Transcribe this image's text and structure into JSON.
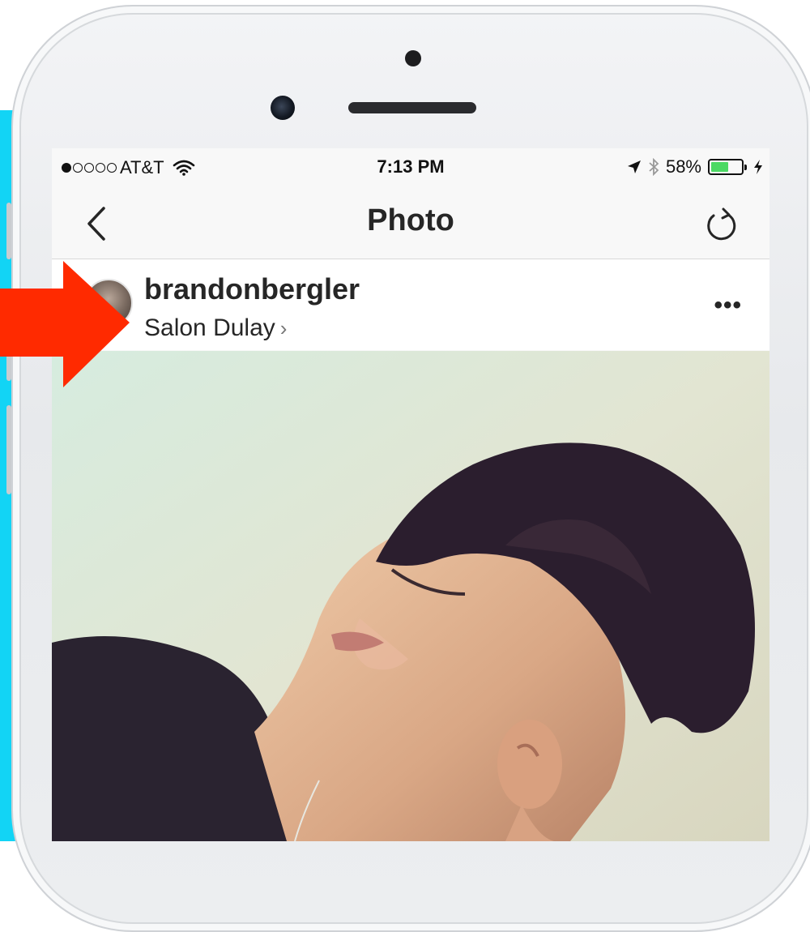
{
  "status_bar": {
    "carrier": "AT&T",
    "time": "7:13 PM",
    "battery_percent": "58%",
    "battery_level": 0.58,
    "signal_bars": 1,
    "signal_total": 5
  },
  "nav": {
    "title": "Photo",
    "back_icon": "chevron-left-icon",
    "refresh_icon": "refresh-icon"
  },
  "post": {
    "username": "brandonbergler",
    "location": "Salon Dulay",
    "location_chevron": "›",
    "more_label": "•••"
  },
  "colors": {
    "annotation_arrow": "#ff2a00",
    "side_background": "#12d4f5",
    "battery_green": "#4cd964"
  }
}
